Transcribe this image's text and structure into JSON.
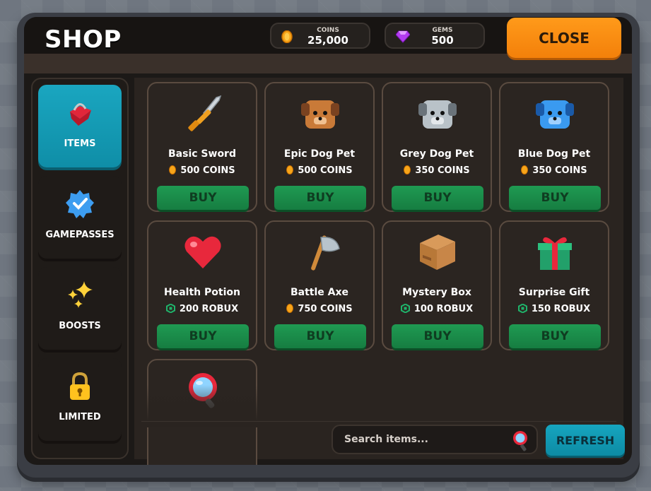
{
  "header": {
    "title": "SHOP",
    "coins": {
      "label": "COINS",
      "value": "25,000",
      "icon": "coin-icon"
    },
    "gems": {
      "label": "GEMS",
      "value": "500",
      "icon": "gem-icon"
    },
    "close_label": "CLOSE"
  },
  "sidebar": {
    "items": [
      {
        "label": "ITEMS",
        "icon": "basket-icon",
        "active": true
      },
      {
        "label": "GAMEPASSES",
        "icon": "verified-badge-icon"
      },
      {
        "label": "BOOSTS",
        "icon": "sparkles-icon"
      },
      {
        "label": "LIMITED",
        "icon": "lock-icon"
      }
    ]
  },
  "items": [
    {
      "name": "Basic Sword",
      "price": "500 COINS",
      "currency": "coins",
      "icon": "sword-icon"
    },
    {
      "name": "Epic Dog Pet",
      "price": "500 COINS",
      "currency": "coins",
      "icon": "brown-dog-icon"
    },
    {
      "name": "Grey Dog Pet",
      "price": "350 COINS",
      "currency": "coins",
      "icon": "grey-dog-icon"
    },
    {
      "name": "Blue Dog Pet",
      "price": "350 COINS",
      "currency": "coins",
      "icon": "blue-dog-icon"
    },
    {
      "name": "Health Potion",
      "price": "200 ROBUX",
      "currency": "robux",
      "icon": "heart-icon"
    },
    {
      "name": "Battle Axe",
      "price": "750 COINS",
      "currency": "coins",
      "icon": "axe-icon"
    },
    {
      "name": "Mystery Box",
      "price": "100 ROBUX",
      "currency": "robux",
      "icon": "box-icon"
    },
    {
      "name": "Surprise Gift",
      "price": "150 ROBUX",
      "currency": "robux",
      "icon": "gift-icon"
    },
    {
      "name": "",
      "price": "",
      "currency": "",
      "icon": "magnifier-icon"
    }
  ],
  "buy_label": "BUY",
  "search": {
    "placeholder": "Search items..."
  },
  "refresh_label": "REFRESH",
  "colors": {
    "accent": "#0f9bb5",
    "close": "#f5860c",
    "buy": "#1a8a49"
  }
}
